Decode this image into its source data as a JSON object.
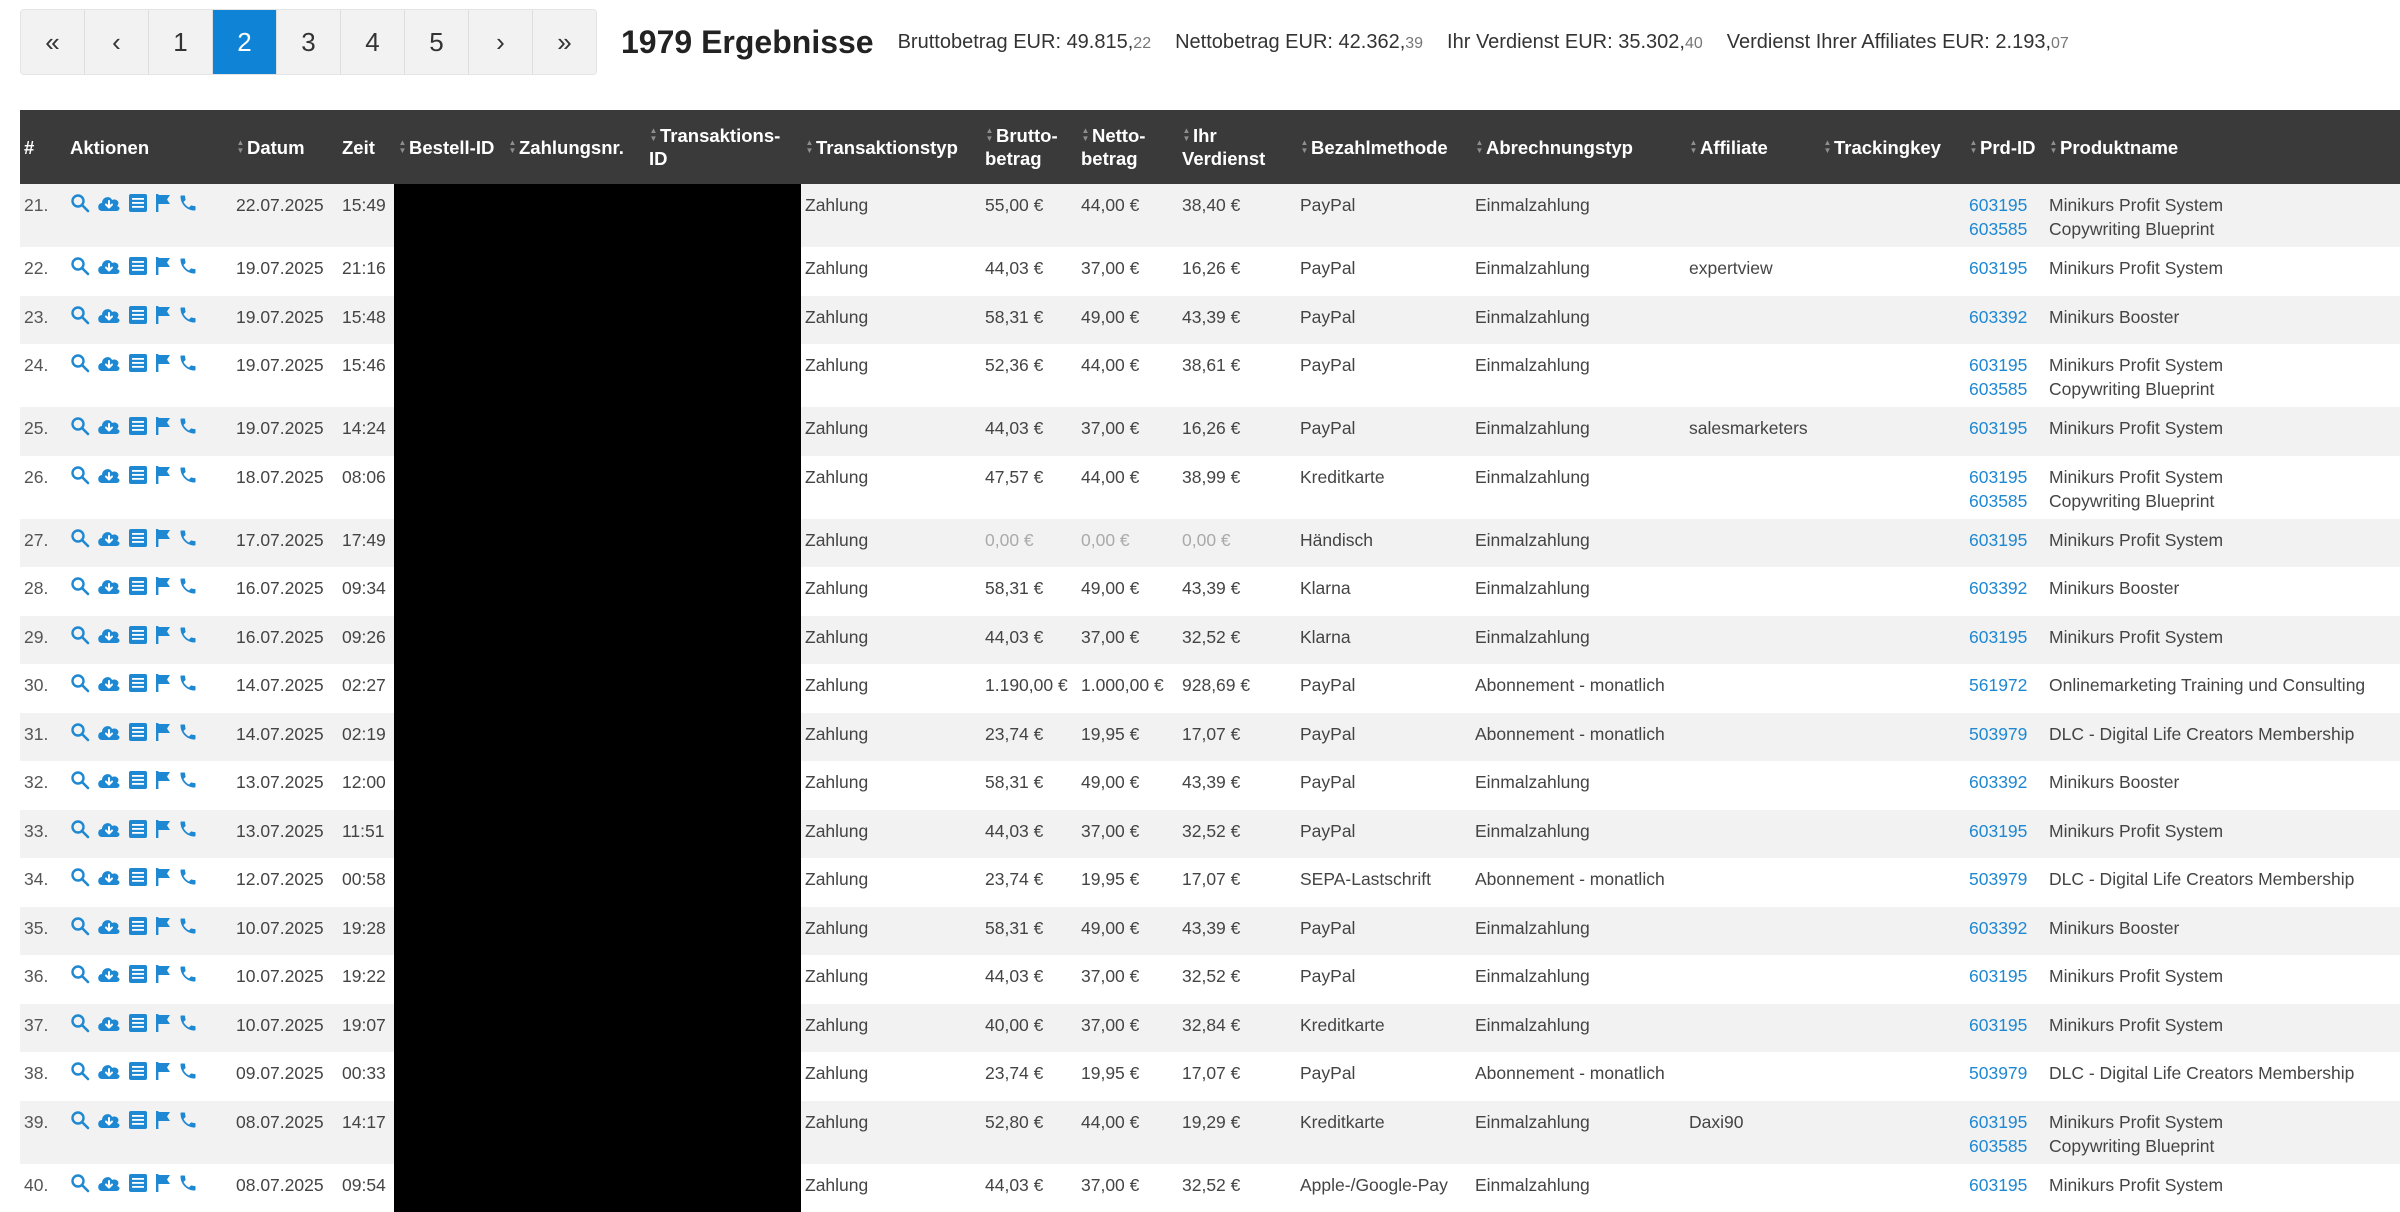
{
  "pagination": {
    "first_label": "«",
    "prev_label": "‹",
    "pages": [
      "1",
      "2",
      "3",
      "4",
      "5"
    ],
    "current": "2",
    "next_label": "›",
    "last_label": "»"
  },
  "summary": {
    "results_label": "1979 Ergebnisse",
    "gross": {
      "label": "Bruttobetrag EUR: ",
      "value": "49.815,",
      "cents": "22"
    },
    "net": {
      "label": "Nettobetrag EUR: ",
      "value": "42.362,",
      "cents": "39"
    },
    "earned": {
      "label": "Ihr Verdienst EUR: ",
      "value": "35.302,",
      "cents": "40"
    },
    "affiliate": {
      "label": "Verdienst Ihrer Affiliates EUR: ",
      "value": "2.193,",
      "cents": "07"
    }
  },
  "columns": [
    {
      "key": "num",
      "label": "#",
      "sortable": false
    },
    {
      "key": "actions",
      "label": "Aktionen",
      "sortable": false
    },
    {
      "key": "date",
      "label": "Datum",
      "sortable": true
    },
    {
      "key": "time",
      "label": "Zeit",
      "sortable": false
    },
    {
      "key": "order_id",
      "label": "Bestell-ID",
      "sortable": true
    },
    {
      "key": "payment_no",
      "label": "Zahlungsnr.",
      "sortable": true
    },
    {
      "key": "transaction_id",
      "label": "Transaktions-ID",
      "sortable": true
    },
    {
      "key": "transaction_type",
      "label": "Transaktionstyp",
      "sortable": true
    },
    {
      "key": "gross",
      "label": "Brutto-betrag",
      "sortable": true
    },
    {
      "key": "net",
      "label": "Netto-betrag",
      "sortable": true
    },
    {
      "key": "earned",
      "label": "Ihr Verdienst",
      "sortable": true
    },
    {
      "key": "payment_method",
      "label": "Bezahlmethode",
      "sortable": true
    },
    {
      "key": "billing_type",
      "label": "Abrechnungstyp",
      "sortable": true
    },
    {
      "key": "affiliate",
      "label": "Affiliate",
      "sortable": true
    },
    {
      "key": "tracking_key",
      "label": "Trackingkey",
      "sortable": true
    },
    {
      "key": "product_id",
      "label": "Prd-ID",
      "sortable": true
    },
    {
      "key": "product_name",
      "label": "Produktname",
      "sortable": true
    }
  ],
  "action_icons": [
    "search-icon",
    "cloud-download-icon",
    "list-icon",
    "flag-icon",
    "phone-icon"
  ],
  "colors": {
    "accent": "#1e88d2",
    "header_bg": "#3a3a3a",
    "row_alt": "#f2f2f2",
    "redacted": "#000000"
  },
  "rows": [
    {
      "num": "21.",
      "date": "22.07.2025",
      "time": "15:49",
      "type": "Zahlung",
      "gross": "55,00 €",
      "net": "44,00 €",
      "earned": "38,40 €",
      "method": "PayPal",
      "billing": "Einmalzahlung",
      "affiliate": "",
      "tracking": "",
      "products": [
        {
          "id": "603195",
          "name": "Minikurs Profit System"
        },
        {
          "id": "603585",
          "name": "Copywriting Blueprint"
        }
      ]
    },
    {
      "num": "22.",
      "date": "19.07.2025",
      "time": "21:16",
      "type": "Zahlung",
      "gross": "44,03 €",
      "net": "37,00 €",
      "earned": "16,26 €",
      "method": "PayPal",
      "billing": "Einmalzahlung",
      "affiliate": "expertview",
      "tracking": "",
      "products": [
        {
          "id": "603195",
          "name": "Minikurs Profit System"
        }
      ]
    },
    {
      "num": "23.",
      "date": "19.07.2025",
      "time": "15:48",
      "type": "Zahlung",
      "gross": "58,31 €",
      "net": "49,00 €",
      "earned": "43,39 €",
      "method": "PayPal",
      "billing": "Einmalzahlung",
      "affiliate": "",
      "tracking": "",
      "products": [
        {
          "id": "603392",
          "name": "Minikurs Booster"
        }
      ]
    },
    {
      "num": "24.",
      "date": "19.07.2025",
      "time": "15:46",
      "type": "Zahlung",
      "gross": "52,36 €",
      "net": "44,00 €",
      "earned": "38,61 €",
      "method": "PayPal",
      "billing": "Einmalzahlung",
      "affiliate": "",
      "tracking": "",
      "products": [
        {
          "id": "603195",
          "name": "Minikurs Profit System"
        },
        {
          "id": "603585",
          "name": "Copywriting Blueprint"
        }
      ]
    },
    {
      "num": "25.",
      "date": "19.07.2025",
      "time": "14:24",
      "type": "Zahlung",
      "gross": "44,03 €",
      "net": "37,00 €",
      "earned": "16,26 €",
      "method": "PayPal",
      "billing": "Einmalzahlung",
      "affiliate": "salesmarketers",
      "tracking": "",
      "products": [
        {
          "id": "603195",
          "name": "Minikurs Profit System"
        }
      ]
    },
    {
      "num": "26.",
      "date": "18.07.2025",
      "time": "08:06",
      "type": "Zahlung",
      "gross": "47,57 €",
      "net": "44,00 €",
      "earned": "38,99 €",
      "method": "Kreditkarte",
      "billing": "Einmalzahlung",
      "affiliate": "",
      "tracking": "",
      "products": [
        {
          "id": "603195",
          "name": "Minikurs Profit System"
        },
        {
          "id": "603585",
          "name": "Copywriting Blueprint"
        }
      ]
    },
    {
      "num": "27.",
      "date": "17.07.2025",
      "time": "17:49",
      "type": "Zahlung",
      "gross": "0,00 €",
      "net": "0,00 €",
      "earned": "0,00 €",
      "zero": true,
      "method": "Händisch",
      "billing": "Einmalzahlung",
      "affiliate": "",
      "tracking": "",
      "products": [
        {
          "id": "603195",
          "name": "Minikurs Profit System"
        }
      ]
    },
    {
      "num": "28.",
      "date": "16.07.2025",
      "time": "09:34",
      "type": "Zahlung",
      "gross": "58,31 €",
      "net": "49,00 €",
      "earned": "43,39 €",
      "method": "Klarna",
      "billing": "Einmalzahlung",
      "affiliate": "",
      "tracking": "",
      "products": [
        {
          "id": "603392",
          "name": "Minikurs Booster"
        }
      ]
    },
    {
      "num": "29.",
      "date": "16.07.2025",
      "time": "09:26",
      "type": "Zahlung",
      "gross": "44,03 €",
      "net": "37,00 €",
      "earned": "32,52 €",
      "method": "Klarna",
      "billing": "Einmalzahlung",
      "affiliate": "",
      "tracking": "",
      "products": [
        {
          "id": "603195",
          "name": "Minikurs Profit System"
        }
      ]
    },
    {
      "num": "30.",
      "date": "14.07.2025",
      "time": "02:27",
      "type": "Zahlung",
      "gross": "1.190,00 €",
      "net": "1.000,00 €",
      "earned": "928,69 €",
      "method": "PayPal",
      "billing": "Abonnement - monatlich",
      "affiliate": "",
      "tracking": "",
      "products": [
        {
          "id": "561972",
          "name": "Onlinemarketing Training und Consulting"
        }
      ]
    },
    {
      "num": "31.",
      "date": "14.07.2025",
      "time": "02:19",
      "type": "Zahlung",
      "gross": "23,74 €",
      "net": "19,95 €",
      "earned": "17,07 €",
      "method": "PayPal",
      "billing": "Abonnement - monatlich",
      "affiliate": "",
      "tracking": "",
      "products": [
        {
          "id": "503979",
          "name": "DLC - Digital Life Creators Membership"
        }
      ]
    },
    {
      "num": "32.",
      "date": "13.07.2025",
      "time": "12:00",
      "type": "Zahlung",
      "gross": "58,31 €",
      "net": "49,00 €",
      "earned": "43,39 €",
      "method": "PayPal",
      "billing": "Einmalzahlung",
      "affiliate": "",
      "tracking": "",
      "products": [
        {
          "id": "603392",
          "name": "Minikurs Booster"
        }
      ]
    },
    {
      "num": "33.",
      "date": "13.07.2025",
      "time": "11:51",
      "type": "Zahlung",
      "gross": "44,03 €",
      "net": "37,00 €",
      "earned": "32,52 €",
      "method": "PayPal",
      "billing": "Einmalzahlung",
      "affiliate": "",
      "tracking": "",
      "products": [
        {
          "id": "603195",
          "name": "Minikurs Profit System"
        }
      ]
    },
    {
      "num": "34.",
      "date": "12.07.2025",
      "time": "00:58",
      "type": "Zahlung",
      "gross": "23,74 €",
      "net": "19,95 €",
      "earned": "17,07 €",
      "method": "SEPA-Lastschrift",
      "billing": "Abonnement - monatlich",
      "affiliate": "",
      "tracking": "",
      "products": [
        {
          "id": "503979",
          "name": "DLC - Digital Life Creators Membership"
        }
      ]
    },
    {
      "num": "35.",
      "date": "10.07.2025",
      "time": "19:28",
      "type": "Zahlung",
      "gross": "58,31 €",
      "net": "49,00 €",
      "earned": "43,39 €",
      "method": "PayPal",
      "billing": "Einmalzahlung",
      "affiliate": "",
      "tracking": "",
      "products": [
        {
          "id": "603392",
          "name": "Minikurs Booster"
        }
      ]
    },
    {
      "num": "36.",
      "date": "10.07.2025",
      "time": "19:22",
      "type": "Zahlung",
      "gross": "44,03 €",
      "net": "37,00 €",
      "earned": "32,52 €",
      "method": "PayPal",
      "billing": "Einmalzahlung",
      "affiliate": "",
      "tracking": "",
      "products": [
        {
          "id": "603195",
          "name": "Minikurs Profit System"
        }
      ]
    },
    {
      "num": "37.",
      "date": "10.07.2025",
      "time": "19:07",
      "type": "Zahlung",
      "gross": "40,00 €",
      "net": "37,00 €",
      "earned": "32,84 €",
      "method": "Kreditkarte",
      "billing": "Einmalzahlung",
      "affiliate": "",
      "tracking": "",
      "products": [
        {
          "id": "603195",
          "name": "Minikurs Profit System"
        }
      ]
    },
    {
      "num": "38.",
      "date": "09.07.2025",
      "time": "00:33",
      "type": "Zahlung",
      "gross": "23,74 €",
      "net": "19,95 €",
      "earned": "17,07 €",
      "method": "PayPal",
      "billing": "Abonnement - monatlich",
      "affiliate": "",
      "tracking": "",
      "products": [
        {
          "id": "503979",
          "name": "DLC - Digital Life Creators Membership"
        }
      ]
    },
    {
      "num": "39.",
      "date": "08.07.2025",
      "time": "14:17",
      "type": "Zahlung",
      "gross": "52,80 €",
      "net": "44,00 €",
      "earned": "19,29 €",
      "method": "Kreditkarte",
      "billing": "Einmalzahlung",
      "affiliate": "Daxi90",
      "tracking": "",
      "products": [
        {
          "id": "603195",
          "name": "Minikurs Profit System"
        },
        {
          "id": "603585",
          "name": "Copywriting Blueprint"
        }
      ]
    },
    {
      "num": "40.",
      "date": "08.07.2025",
      "time": "09:54",
      "type": "Zahlung",
      "gross": "44,03 €",
      "net": "37,00 €",
      "earned": "32,52 €",
      "method": "Apple-/Google-Pay",
      "billing": "Einmalzahlung",
      "affiliate": "",
      "tracking": "",
      "products": [
        {
          "id": "603195",
          "name": "Minikurs Profit System"
        }
      ]
    }
  ]
}
